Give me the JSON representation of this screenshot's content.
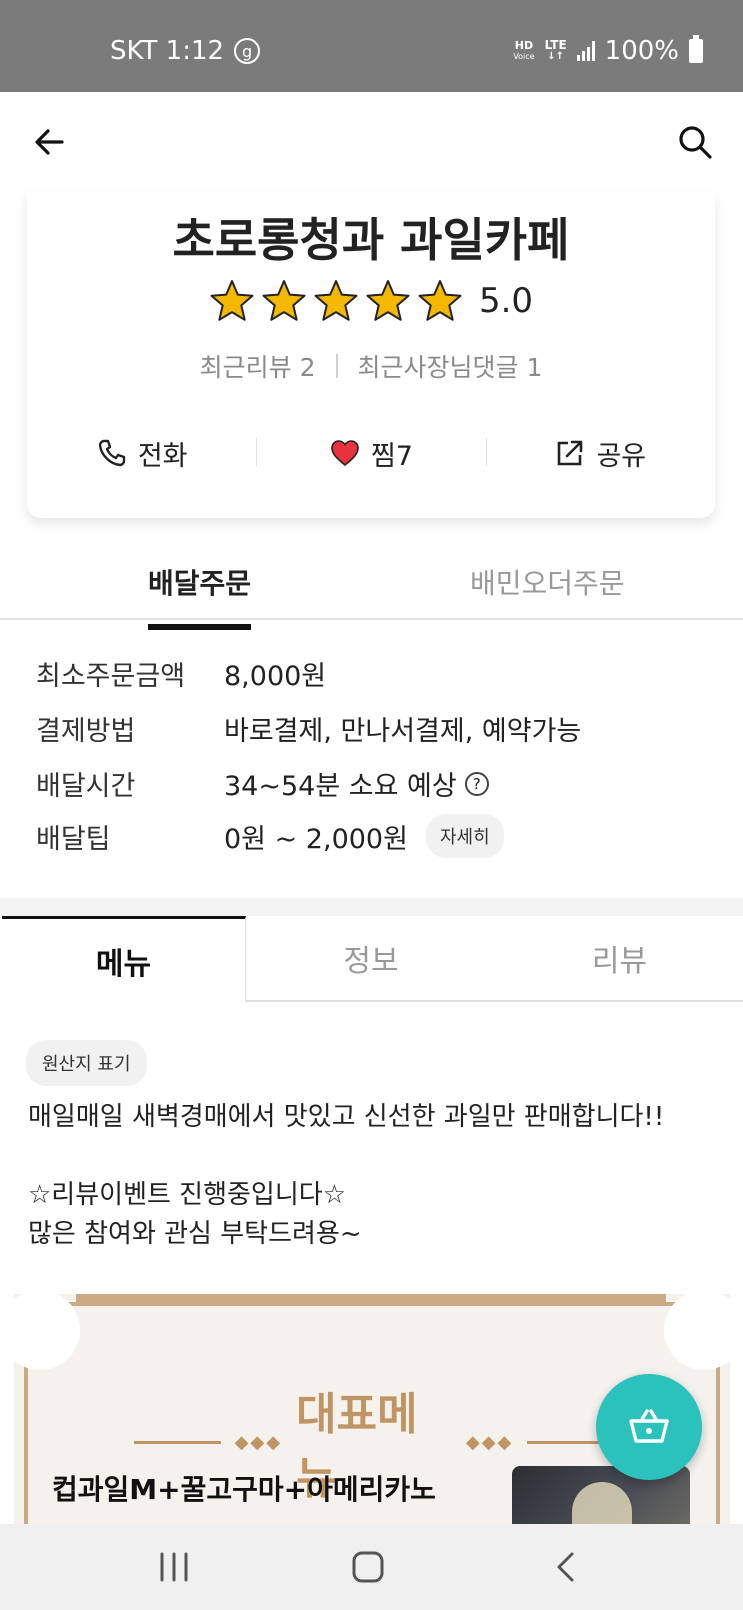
{
  "status_bar": {
    "carrier_time": "SKT 1:12",
    "g_icon": "g",
    "hd_label": "HD",
    "voice_label": "Voice",
    "lte_label": "LTE",
    "battery_text": "100%"
  },
  "store": {
    "name": "초로롱청과 과일카페",
    "rating": "5.0",
    "rating_stars": 5,
    "recent_reviews": "최근리뷰 2",
    "recent_owner_comments": "최근사장님댓글 1"
  },
  "actions": {
    "call": "전화",
    "like": "찜7",
    "share": "공유"
  },
  "order_tabs": {
    "delivery": "배달주문",
    "baemin_order": "배민오더주문"
  },
  "info": {
    "min_order_label": "최소주문금액",
    "min_order_value": "8,000원",
    "payment_label": "결제방법",
    "payment_value": "바로결제, 만나서결제, 예약가능",
    "delivery_time_label": "배달시간",
    "delivery_time_value": "34~54분 소요 예상",
    "delivery_tip_label": "배달팁",
    "delivery_tip_value": "0원 ~ 2,000원",
    "detail_button": "자세히"
  },
  "menu_tabs": {
    "menu": "메뉴",
    "info": "정보",
    "review": "리뷰"
  },
  "content": {
    "origin_chip": "원산지 표기",
    "notice": "매일매일 새벽경매에서 맛있고 신선한 과일만 판매합니다!!\n\n☆리뷰이벤트 진행중입니다☆\n많은 참여와 관심 부탁드려용~"
  },
  "banner": {
    "diamonds": "◆◆◆",
    "title": "대표메뉴",
    "item_name": "컵과일M+꿀고구마+아메리카노"
  },
  "colors": {
    "accent_teal": "#2bc1bc",
    "banner_gold": "#c09564",
    "star_yellow": "#f5b800",
    "heart_red": "#e8323c"
  },
  "icons": [
    "back-arrow-icon",
    "search-icon",
    "star-icon",
    "phone-icon",
    "heart-icon",
    "share-icon",
    "question-icon",
    "cart-icon",
    "recent-apps-icon",
    "home-icon",
    "back-icon"
  ]
}
